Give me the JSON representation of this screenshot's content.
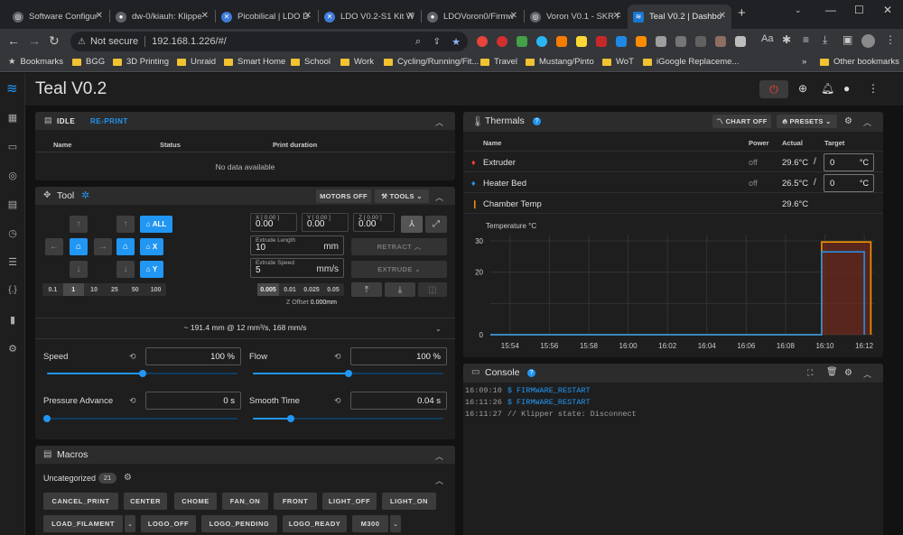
{
  "browser": {
    "tabs": [
      {
        "title": "Software Configur"
      },
      {
        "title": "dw-0/kiauh: Klippe"
      },
      {
        "title": "Picobilical | LDO D"
      },
      {
        "title": "LDO V0.2-S1 Kit W"
      },
      {
        "title": "LDOVoron0/Firmw"
      },
      {
        "title": "Voron V0.1 - SKR P"
      },
      {
        "title": "Teal V0.2 | Dashbo"
      }
    ],
    "address": {
      "security": "Not secure",
      "url": "192.168.1.226/#/"
    },
    "bookmarks": [
      "Bookmarks",
      "BGG",
      "3D Printing",
      "Unraid",
      "Smart Home",
      "School",
      "Work",
      "Cycling/Running/Fit...",
      "Travel",
      "Mustang/Pinto",
      "WoT",
      "iGoogle Replaceme...",
      "Other bookmarks"
    ],
    "more_bookmarks": "»"
  },
  "app": {
    "title": "Teal V0.2",
    "status_panel": {
      "tab_idle": "IDLE",
      "tab_reprint": "RE-PRINT",
      "columns": [
        "Name",
        "Status",
        "Print duration"
      ],
      "empty_text": "No data available"
    },
    "tool": {
      "title": "Tool",
      "motors_off": "MOTORS OFF",
      "tools": "TOOLS",
      "home_all": "ALL",
      "home_x": "X",
      "home_y": "Y",
      "steps": [
        "0.1",
        "1",
        "10",
        "25",
        "50",
        "100"
      ],
      "selected_step": "1",
      "pos_x_label": "X [ 0.00 ]",
      "pos_x_value": "0.00",
      "pos_y_label": "Y [ 0.00 ]",
      "pos_y_value": "0.00",
      "pos_z_label": "Z [ 0.00 ]",
      "pos_z_value": "0.00",
      "extrude_length_label": "Extrude Length",
      "extrude_length": "10",
      "extrude_length_unit": "mm",
      "extrude_speed_label": "Extrude Speed",
      "extrude_speed": "5",
      "extrude_speed_unit": "mm/s",
      "retract": "RETRACT",
      "extrude": "EXTRUDE",
      "z_steps": [
        "0.005",
        "0.01",
        "0.025",
        "0.05"
      ],
      "selected_z_step": "0.005",
      "z_offset_label": "Z Offset",
      "z_offset": "0.000mm",
      "flow_info": "~ 191.4 mm @ 12 mm³/s, 168 mm/s"
    },
    "tuning": {
      "speed_label": "Speed",
      "speed_value": "100 %",
      "speed_level": 0.5,
      "flow_label": "Flow",
      "flow_value": "100 %",
      "flow_level": 0.5,
      "pa_label": "Pressure Advance",
      "pa_value": "0 s",
      "pa_level": 0,
      "smooth_label": "Smooth Time",
      "smooth_value": "0.04 s",
      "smooth_level": 0.2
    },
    "macros": {
      "title": "Macros",
      "group": "Uncategorized",
      "count": "21",
      "row1": [
        "CANCEL_PRINT",
        "CENTER",
        "CHOME",
        "FAN_ON",
        "FRONT",
        "LIGHT_OFF",
        "LIGHT_ON"
      ],
      "row2": [
        "LOAD_FILAMENT",
        "LOGO_OFF",
        "LOGO_PENDING",
        "LOGO_READY",
        "M300"
      ]
    },
    "thermals": {
      "title": "Thermals",
      "chart_off": "CHART OFF",
      "presets": "PRESETS",
      "columns": {
        "name": "Name",
        "power": "Power",
        "actual": "Actual",
        "target": "Target"
      },
      "rows": [
        {
          "name": "Extruder",
          "power": "off",
          "actual": "29.6°C",
          "target": "0",
          "unit": "°C",
          "icon": "fire-icon",
          "color": "#f44336"
        },
        {
          "name": "Heater Bed",
          "power": "off",
          "actual": "26.5°C",
          "target": "0",
          "unit": "°C",
          "icon": "radiator-icon",
          "color": "#2196f3"
        },
        {
          "name": "Chamber Temp",
          "actual": "29.6°C",
          "icon": "thermometer-icon",
          "color": "#ff9800"
        }
      ]
    },
    "console": {
      "title": "Console",
      "lines": [
        {
          "time": "16:09:10",
          "kind": "cmd",
          "text": "$ FIRMWARE_RESTART"
        },
        {
          "time": "16:11:26",
          "kind": "cmd",
          "text": "$ FIRMWARE_RESTART"
        },
        {
          "time": "16:11:27",
          "kind": "comment",
          "text": "// Klipper state: Disconnect"
        }
      ]
    }
  },
  "chart_data": {
    "type": "line",
    "ylabel": "Temperature °C",
    "ylim": [
      0,
      32
    ],
    "yticks": [
      "0",
      "10",
      "20",
      "30"
    ],
    "xticks": [
      "15:54",
      "15:56",
      "15:58",
      "16:00",
      "16:02",
      "16:04",
      "16:06",
      "16:08",
      "16:10",
      "16:12"
    ],
    "x_range": [
      "15:53",
      "16:12:30"
    ],
    "grid": true,
    "series": [
      {
        "color": "#ff9800",
        "x": [
          "15:53",
          "16:09:50",
          "16:09:50",
          "16:12:20",
          "16:12:20"
        ],
        "y": [
          0,
          0,
          29.6,
          29.6,
          0
        ]
      },
      {
        "color": "#2196f3",
        "x": [
          "15:53",
          "16:09:50",
          "16:09:50",
          "16:12:00",
          "16:12:00"
        ],
        "y": [
          0,
          0,
          26.5,
          26.5,
          0
        ]
      }
    ],
    "shaded": {
      "x_start": "16:09:50",
      "x_end": "16:12:20",
      "color": "#6d2a1e"
    }
  }
}
